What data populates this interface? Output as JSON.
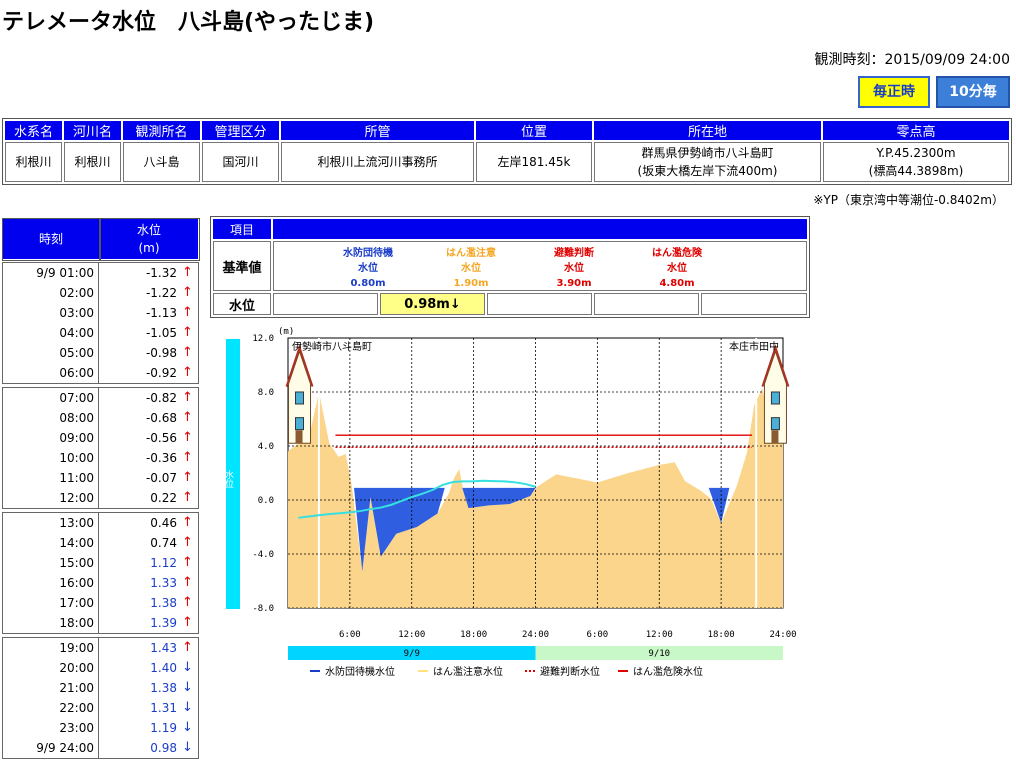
{
  "title": "テレメータ水位　八斗島(やったじま)",
  "observation": {
    "label": "観測時刻：2015/09/09 24:00"
  },
  "buttons": {
    "hourly": "毎正時",
    "ten_min": "10分毎"
  },
  "info_table": {
    "headers": [
      "水系名",
      "河川名",
      "観測所名",
      "管理区分",
      "所管",
      "位置",
      "所在地",
      "零点高"
    ],
    "row": {
      "system": "利根川",
      "river": "利根川",
      "station": "八斗島",
      "management": "国河川",
      "office": "利根川上流河川事務所",
      "position": "左岸181.45k",
      "location1": "群馬県伊勢崎市八斗島町",
      "location2": "(坂東大橋左岸下流400m)",
      "zero1": "Y.P.45.2300m",
      "zero2": "(標高44.3898m)"
    },
    "note": "※YP（東京湾中等潮位-0.8402m）"
  },
  "history": {
    "header_time": "時刻",
    "header_level1": "水位",
    "header_level2": "(m)",
    "groups": [
      [
        {
          "t": "9/9 01:00",
          "v": "-1.32",
          "a": "↑",
          "dir": "up",
          "blue": false
        },
        {
          "t": "02:00",
          "v": "-1.22",
          "a": "↑",
          "dir": "up",
          "blue": false
        },
        {
          "t": "03:00",
          "v": "-1.13",
          "a": "↑",
          "dir": "up",
          "blue": false
        },
        {
          "t": "04:00",
          "v": "-1.05",
          "a": "↑",
          "dir": "up",
          "blue": false
        },
        {
          "t": "05:00",
          "v": "-0.98",
          "a": "↑",
          "dir": "up",
          "blue": false
        },
        {
          "t": "06:00",
          "v": "-0.92",
          "a": "↑",
          "dir": "up",
          "blue": false
        }
      ],
      [
        {
          "t": "07:00",
          "v": "-0.82",
          "a": "↑",
          "dir": "up",
          "blue": false
        },
        {
          "t": "08:00",
          "v": "-0.68",
          "a": "↑",
          "dir": "up",
          "blue": false
        },
        {
          "t": "09:00",
          "v": "-0.56",
          "a": "↑",
          "dir": "up",
          "blue": false
        },
        {
          "t": "10:00",
          "v": "-0.36",
          "a": "↑",
          "dir": "up",
          "blue": false
        },
        {
          "t": "11:00",
          "v": "-0.07",
          "a": "↑",
          "dir": "up",
          "blue": false
        },
        {
          "t": "12:00",
          "v": "0.22",
          "a": "↑",
          "dir": "up",
          "blue": false
        }
      ],
      [
        {
          "t": "13:00",
          "v": "0.46",
          "a": "↑",
          "dir": "up",
          "blue": false
        },
        {
          "t": "14:00",
          "v": "0.74",
          "a": "↑",
          "dir": "up",
          "blue": false
        },
        {
          "t": "15:00",
          "v": "1.12",
          "a": "↑",
          "dir": "up",
          "blue": true
        },
        {
          "t": "16:00",
          "v": "1.33",
          "a": "↑",
          "dir": "up",
          "blue": true
        },
        {
          "t": "17:00",
          "v": "1.38",
          "a": "↑",
          "dir": "up",
          "blue": true
        },
        {
          "t": "18:00",
          "v": "1.39",
          "a": "↑",
          "dir": "up",
          "blue": true
        }
      ],
      [
        {
          "t": "19:00",
          "v": "1.43",
          "a": "↑",
          "dir": "up",
          "blue": true
        },
        {
          "t": "20:00",
          "v": "1.40",
          "a": "↓",
          "dir": "down",
          "blue": true
        },
        {
          "t": "21:00",
          "v": "1.38",
          "a": "↓",
          "dir": "down",
          "blue": true
        },
        {
          "t": "22:00",
          "v": "1.31",
          "a": "↓",
          "dir": "down",
          "blue": true
        },
        {
          "t": "23:00",
          "v": "1.19",
          "a": "↓",
          "dir": "down",
          "blue": true
        },
        {
          "t": "9/9 24:00",
          "v": "0.98",
          "a": "↓",
          "dir": "down",
          "blue": true
        }
      ]
    ]
  },
  "reference": {
    "header_item": "項目",
    "label_ref": "基準値",
    "label_level": "水位",
    "levels": [
      {
        "name": "水防団待機",
        "sub": "水位",
        "value": "0.80m",
        "color": "#1a3dc8"
      },
      {
        "name": "はん濫注意",
        "sub": "水位",
        "value": "1.90m",
        "color": "#f5a623"
      },
      {
        "name": "避難判断",
        "sub": "水位",
        "value": "3.90m",
        "color": "#e00000"
      },
      {
        "name": "はん濫危険",
        "sub": "水位",
        "value": "4.80m",
        "color": "#e00000"
      }
    ],
    "current": "0.98m↓"
  },
  "chart_data": {
    "type": "area",
    "unit_label": "(m)",
    "ylabel": "水位",
    "ylim": [
      -8.0,
      12.0
    ],
    "yticks": [
      "12.0",
      "8.0",
      "4.0",
      "0.0",
      "-4.0",
      "-8.0"
    ],
    "xticks": [
      "6:00",
      "12:00",
      "18:00",
      "24:00",
      "6:00",
      "12:00",
      "18:00",
      "24:00"
    ],
    "days": [
      "9/9",
      "9/10"
    ],
    "left_bank_label": "伊勢崎市八斗島町",
    "right_bank_label": "本庄市田中",
    "thresholds": [
      {
        "name": "水防団待機水位",
        "value": 0.8,
        "color": "#1a3dc8",
        "style": "solid"
      },
      {
        "name": "はん濫注意水位",
        "value": 1.9,
        "color": "#ffe27a",
        "style": "solid"
      },
      {
        "name": "避難判断水位",
        "value": 3.9,
        "color": "#e00000",
        "style": "dotted"
      },
      {
        "name": "はん濫危険水位",
        "value": 4.8,
        "color": "#e00000",
        "style": "solid"
      }
    ],
    "series": [
      {
        "name": "水位",
        "hours": [
          1,
          2,
          3,
          4,
          5,
          6,
          7,
          8,
          9,
          10,
          11,
          12,
          13,
          14,
          15,
          16,
          17,
          18,
          19,
          20,
          21,
          22,
          23,
          24
        ],
        "values": [
          -1.32,
          -1.22,
          -1.13,
          -1.05,
          -0.98,
          -0.92,
          -0.82,
          -0.68,
          -0.56,
          -0.36,
          -0.07,
          0.22,
          0.46,
          0.74,
          1.12,
          1.33,
          1.38,
          1.39,
          1.43,
          1.4,
          1.38,
          1.31,
          1.19,
          0.98
        ],
        "color": "#35e0e0"
      }
    ]
  }
}
